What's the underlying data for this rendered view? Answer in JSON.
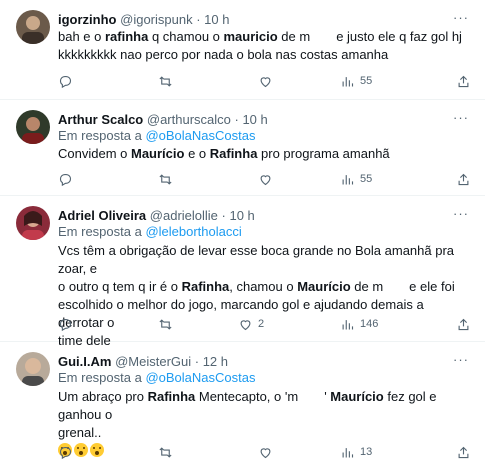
{
  "tweets": [
    {
      "name": "igorzinho",
      "handle": "@igorispunk",
      "time": "· 10 h",
      "text_line1_a": "bah e o ",
      "text_line1_b": "rafinha",
      "text_line1_c": " q chamou o ",
      "text_line1_d": "mauricio",
      "text_line1_e": " de m",
      "text_line1_f": "e justo ele q faz gol hj",
      "text_line2": "kkkkkkkkk nao perco por nada o bola nas costas amanha",
      "views": "55",
      "avatar_color": "#6b5a4a"
    },
    {
      "name": "Arthur Scalco",
      "handle": "@arthurscalco",
      "time": "· 10 h",
      "reply_prefix": "Em resposta a ",
      "reply_handle": "@oBolaNasCostas",
      "text_a": "Convidem o ",
      "text_b": "Maurício",
      "text_c": " e o ",
      "text_d": "Rafinha",
      "text_e": " pro programa amanhã",
      "views": "55",
      "avatar_color": "#2f3a2a"
    },
    {
      "name": "Adriel Oliveira",
      "handle": "@adrielollie",
      "time": "· 10 h",
      "reply_prefix": "Em resposta a ",
      "reply_handle": "@lelebortholacci",
      "line1": "Vcs têm a obrigação de levar esse boca grande no Bola amanhã pra zoar, e",
      "line2_a": "o outro q tem q ir é o ",
      "line2_b": "Rafinha",
      "line2_c": ", chamou o ",
      "line2_d": "Maurício",
      "line2_e": " de m",
      "line2_f": "e ele foi",
      "line3": "escolhido o melhor do jogo, marcando gol e ajudando demais a derrotar o",
      "line4": "time dele",
      "likes": "2",
      "views": "146",
      "avatar_color": "#8a2b3a"
    },
    {
      "name": "Gui.I.Am",
      "handle": "@MeisterGui",
      "time": "· 12 h",
      "reply_prefix": "Em resposta a ",
      "reply_handle": "@oBolaNasCostas",
      "line1_a": "Um abraço pro ",
      "line1_b": "Rafinha",
      "line1_c": " Mentecapto, o 'm",
      "line1_d": "' ",
      "line1_e": "Maurício",
      "line1_f": " fez gol e ganhou o",
      "line2": "grenal..",
      "views": "13",
      "avatar_color": "#9a8a7a"
    }
  ],
  "more_label": "···"
}
